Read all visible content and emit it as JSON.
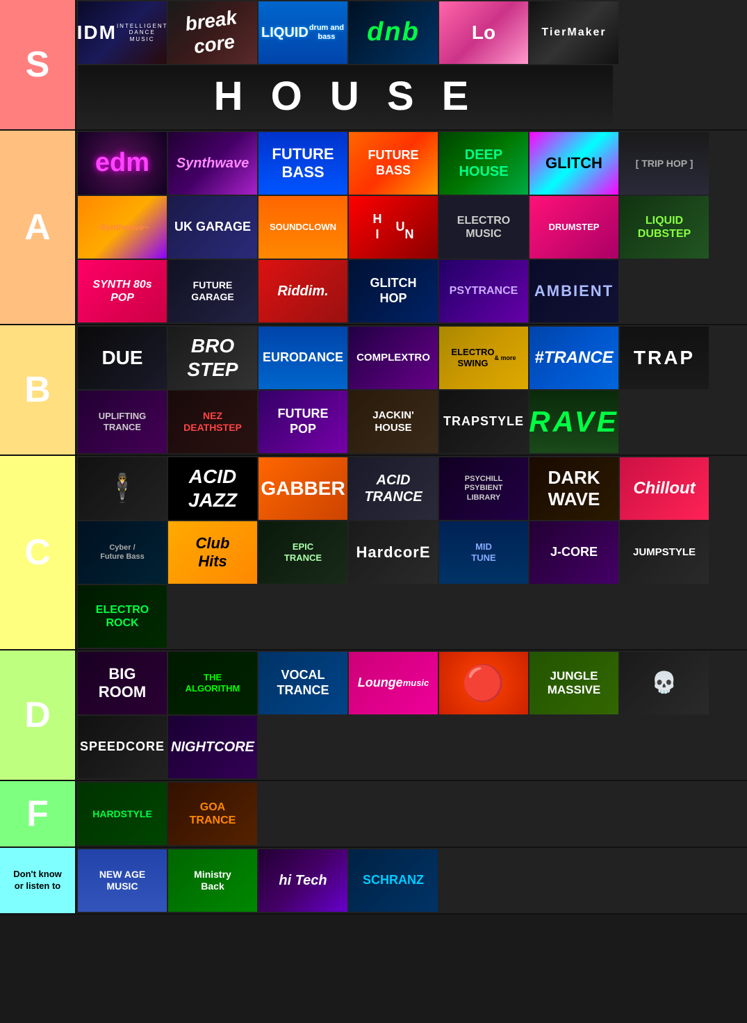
{
  "tiers": [
    {
      "id": "s",
      "label": "S",
      "color": "#ff7f7f",
      "rows": [
        [
          {
            "id": "idm",
            "label": "IDM\nINTELLIGENT DANCE MUSIC",
            "style": "tile-idm"
          },
          {
            "id": "breakcore",
            "label": "break\ncore",
            "style": "tile-breakcore"
          },
          {
            "id": "liquid-dnb",
            "label": "LIQUID\ndrum and bass",
            "style": "tile-liquid-dnb"
          },
          {
            "id": "dnb",
            "label": "dnb",
            "style": "tile-dnb"
          },
          {
            "id": "lo",
            "label": "Lo",
            "style": "tile-lo"
          },
          {
            "id": "tiermaker",
            "label": "TierMaker",
            "style": "tile-tiermaker"
          }
        ],
        [
          {
            "id": "house",
            "label": "H O U S E",
            "style": "tile-house",
            "wide": true,
            "fullrow": true
          }
        ]
      ]
    },
    {
      "id": "a",
      "label": "A",
      "color": "#ffbf7f",
      "rows": [
        [
          {
            "id": "edm",
            "label": "edm",
            "style": "tile-edm"
          },
          {
            "id": "synthwave",
            "label": "Synthwave",
            "style": "tile-synthwave"
          },
          {
            "id": "future-bass",
            "label": "FUTURE\nBASS",
            "style": "tile-future-bass"
          },
          {
            "id": "future-bass2",
            "label": "FUTURE BASS",
            "style": "tile-future-bass2"
          },
          {
            "id": "deep-house",
            "label": "DEEP\nHOUSE",
            "style": "tile-deep-house"
          },
          {
            "id": "glitch",
            "label": "GLITCH",
            "style": "tile-glitch"
          }
        ],
        [
          {
            "id": "trip-hop",
            "label": "[TRIP HOP]",
            "style": "tile-trip-hop"
          },
          {
            "id": "synthwave2",
            "label": "~Synthwave~",
            "style": "tile-synthwave2"
          },
          {
            "id": "uk-garage",
            "label": "UK GARAGE",
            "style": "tile-uk-garage"
          },
          {
            "id": "soundclown",
            "label": "SOUNDCLOWN",
            "style": "tile-soundclown"
          },
          {
            "id": "hun",
            "label": "H I U N",
            "style": "tile-hun"
          },
          {
            "id": "electro-music",
            "label": "ELECTRO\nMUSIC",
            "style": "tile-electro-music"
          }
        ],
        [
          {
            "id": "drumstep",
            "label": "DRUMSTEP",
            "style": "tile-drumstep"
          },
          {
            "id": "liquid-dubstep",
            "label": "LIQUID\nDUBSTEP",
            "style": "tile-liquid-dubstep"
          },
          {
            "id": "synth-pop",
            "label": "SYNTH 80s\nPOP",
            "style": "tile-synth-pop"
          },
          {
            "id": "future-garage",
            "label": "FUTURE\nGARAGE",
            "style": "tile-future-garage"
          },
          {
            "id": "riddim",
            "label": "Riddim.",
            "style": "tile-riddim"
          },
          {
            "id": "glitch-hop",
            "label": "GLITCH\nHOP",
            "style": "tile-glitch-hop"
          }
        ],
        [
          {
            "id": "psytrance",
            "label": "PSYTRANCE",
            "style": "tile-psytrance"
          },
          {
            "id": "ambient",
            "label": "AMBIENT",
            "style": "tile-ambient"
          }
        ]
      ]
    },
    {
      "id": "b",
      "label": "B",
      "color": "#ffdf7f",
      "rows": [
        [
          {
            "id": "dubstep",
            "label": "DUE",
            "style": "tile-dubstep"
          },
          {
            "id": "brostep",
            "label": "BRO\nSTEP",
            "style": "tile-brostep"
          },
          {
            "id": "eurodance",
            "label": "EURODANCE",
            "style": "tile-eurodance"
          },
          {
            "id": "complextro",
            "label": "COMPLEXTRO",
            "style": "tile-complextro"
          },
          {
            "id": "electro-swing",
            "label": "ELECTRO\nSWING\n& more",
            "style": "tile-electro-swing"
          },
          {
            "id": "trance",
            "label": "#TRANCE",
            "style": "tile-trance"
          }
        ],
        [
          {
            "id": "trap",
            "label": "TRAP",
            "style": "tile-trap"
          },
          {
            "id": "uplifting-trance",
            "label": "UPLIFTING\nTRANCE",
            "style": "tile-uplifting-trance"
          },
          {
            "id": "deathstep",
            "label": "NEZ\nDEATHSTEP",
            "style": "tile-deathstep"
          },
          {
            "id": "future-pop",
            "label": "FUTURE\nPOP",
            "style": "tile-future-pop"
          },
          {
            "id": "jackin-house",
            "label": "JACKIN'\nHOUSE",
            "style": "tile-jackin-house"
          },
          {
            "id": "trapstyle",
            "label": "TRAPSTYLE",
            "style": "tile-trapstyle"
          }
        ],
        [
          {
            "id": "rave",
            "label": "RAVE",
            "style": "tile-rave"
          }
        ]
      ]
    },
    {
      "id": "c",
      "label": "C",
      "color": "#ffff7f",
      "rows": [
        [
          {
            "id": "acid-jazz-person",
            "label": "",
            "style": "tile-idm"
          },
          {
            "id": "acid-jazz",
            "label": "ACID\nJAZZ",
            "style": "tile-acid-jazz"
          },
          {
            "id": "gabber",
            "label": "GABBER",
            "style": "tile-gabber"
          },
          {
            "id": "acid-trance",
            "label": "ACID\nTRANCE",
            "style": "tile-acid-trance"
          },
          {
            "id": "psychill",
            "label": "PSYCHILL\nPSYBIENT\nLIBRARY",
            "style": "tile-psychill"
          },
          {
            "id": "dark-wave",
            "label": "DARK\nWAVE",
            "style": "tile-dark-wave"
          }
        ],
        [
          {
            "id": "chillout",
            "label": "Chillout",
            "style": "tile-chillout"
          },
          {
            "id": "cyber",
            "label": "Cyber / Future\nBass",
            "style": "tile-cyber"
          },
          {
            "id": "club-hits",
            "label": "Club\nHits",
            "style": "tile-club-hits"
          },
          {
            "id": "epic-trance",
            "label": "EPIC TRANCE",
            "style": "tile-epic-trance"
          },
          {
            "id": "hardcore",
            "label": "HardcorE",
            "style": "tile-hardcore"
          },
          {
            "id": "midtune",
            "label": "MIDTUNE",
            "style": "tile-midtune"
          }
        ],
        [
          {
            "id": "jcore",
            "label": "J-CORE",
            "style": "tile-jcore"
          },
          {
            "id": "jumpstyle",
            "label": "JUMPSTYLE",
            "style": "tile-jumpstyle"
          },
          {
            "id": "electro-rock",
            "label": "ELECTRO\nROCK",
            "style": "tile-electro-rock"
          }
        ]
      ]
    },
    {
      "id": "d",
      "label": "D",
      "color": "#bfff7f",
      "rows": [
        [
          {
            "id": "big-room",
            "label": "BIG\nROOM",
            "style": "tile-big-room"
          },
          {
            "id": "algorithm",
            "label": "THE ALGORITHM",
            "style": "tile-algorithm"
          },
          {
            "id": "vocal-trance",
            "label": "VOCAL\nTRANCE",
            "style": "tile-vocal-trance"
          },
          {
            "id": "lounge",
            "label": "Lounge\nmusic",
            "style": "tile-lounge"
          },
          {
            "id": "orange-circle",
            "label": "",
            "style": "tile-orange-circle"
          },
          {
            "id": "jungle",
            "label": "JUNGLE\nMASSIVE",
            "style": "tile-jungle"
          }
        ],
        [
          {
            "id": "deathmask",
            "label": "",
            "style": "tile-deathmask"
          },
          {
            "id": "speedcore",
            "label": "SPEEDCORE",
            "style": "tile-speedcore"
          },
          {
            "id": "nightcore",
            "label": "NIGHTCORE",
            "style": "tile-nightcore"
          }
        ]
      ]
    },
    {
      "id": "f",
      "label": "F",
      "color": "#7fff7f",
      "rows": [
        [
          {
            "id": "hardstyle",
            "label": "HARDSTYLE",
            "style": "tile-hardstyle"
          },
          {
            "id": "goa-trance",
            "label": "GOA\nTRANCE",
            "style": "tile-goa-trance"
          }
        ]
      ]
    },
    {
      "id": "dk",
      "label": "Don't know\nor listen to",
      "color": "#7fffff",
      "rows": [
        [
          {
            "id": "new-age",
            "label": "NEW AGE MUSIC",
            "style": "tile-new-age"
          },
          {
            "id": "ministry-back",
            "label": "Ministry\nBack",
            "style": "tile-ministry-back"
          },
          {
            "id": "hitech",
            "label": "hi Tech",
            "style": "tile-hitech"
          },
          {
            "id": "schranz",
            "label": "SCHRANZ",
            "style": "tile-schranz"
          }
        ]
      ]
    }
  ]
}
